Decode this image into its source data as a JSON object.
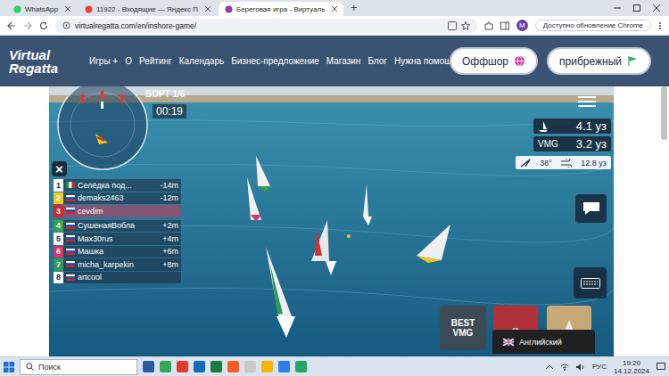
{
  "browser": {
    "tabs": [
      {
        "label": "WhatsApp",
        "selected": false
      },
      {
        "label": "11922 - Входящие — Яндекс П",
        "selected": false
      },
      {
        "label": "Береговая игра - Виртуаль",
        "selected": true
      }
    ],
    "new_tab": "+",
    "url": "virtualregatta.com/en/inshore-game/",
    "profile": "M",
    "update_notice": "Доступно обновление Chrome"
  },
  "site": {
    "logo": "Virtual Regatta",
    "nav": [
      "Игры +",
      "О",
      "Рейтинг",
      "Календарь",
      "Бизнес-предложение",
      "Магазин",
      "Блог",
      "Нужна помощь?"
    ],
    "modes": [
      {
        "label": "Оффшор",
        "kind": "globe"
      },
      {
        "label": "прибрежный",
        "kind": "flag"
      }
    ]
  },
  "game": {
    "leg": "БОРТ 1/6",
    "timer": "00:19",
    "close": "×",
    "leaderboard": [
      {
        "rank": "1",
        "name": "Селёдка под...",
        "gap": "-14m",
        "color": "#ffffff",
        "kind": "it",
        "selected": false
      },
      {
        "rank": "2",
        "name": "demaks2463",
        "gap": "-12m",
        "color": "#f2c81f",
        "kind": "ru",
        "selected": false
      },
      {
        "rank": "3",
        "name": "cevdim",
        "color": "#d8232a",
        "kind": "ru",
        "selected": true
      },
      {
        "rank": "4",
        "name": "СушенаяВобла",
        "gap": "+2m",
        "color": "#3aa34a",
        "kind": "ru",
        "selected": false
      },
      {
        "rank": "5",
        "name": "Max30rus",
        "gap": "+4m",
        "color": "#ffffff",
        "kind": "ru",
        "selected": false
      },
      {
        "rank": "6",
        "name": "Машка",
        "gap": "+6m",
        "color": "#e0306a",
        "kind": "ru",
        "selected": false
      },
      {
        "rank": "7",
        "name": "micha_karpekin",
        "gap": "+8m",
        "color": "#2f9a57",
        "kind": "ru",
        "selected": false
      },
      {
        "rank": "8",
        "name": "artcool",
        "color": "#ffffff",
        "kind": "ru",
        "selected": false
      }
    ],
    "speed": "4.1 уз",
    "vmg_label": "VMG",
    "vmg": "3.2 уз",
    "wind_angle": "38°",
    "wind_speed": "12.8 уз",
    "best_vmg": "BEST VMG"
  },
  "language_popup": "Английский",
  "taskbar": {
    "search": "Поиск",
    "language": "РУС",
    "time": "19:20",
    "date": "14.12.2024"
  }
}
